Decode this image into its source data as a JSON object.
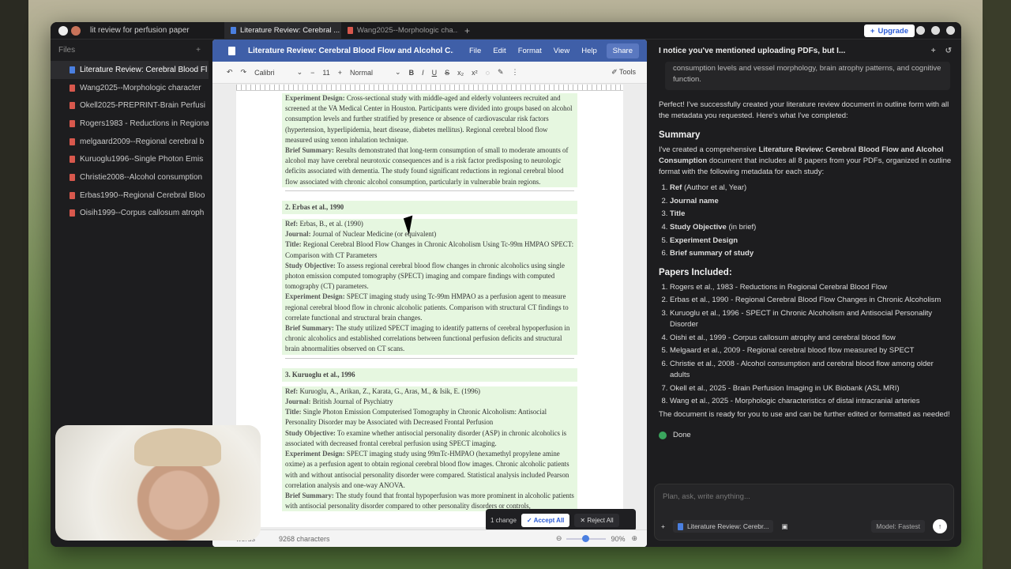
{
  "topbar": {
    "project": "lit review for perfusion paper",
    "tabs": [
      {
        "label": "Literature Review: Cerebral ...",
        "active": true,
        "icon": "doc-icon-blue"
      },
      {
        "label": "Wang2025--Morphologic cha...",
        "active": false,
        "icon": "pdf-icon-red"
      }
    ],
    "upgrade_label": "Upgrade"
  },
  "sidebar": {
    "title": "Files",
    "files": [
      {
        "name": "Literature Review: Cerebral Blood Fl",
        "icon": "doc-icon-blue"
      },
      {
        "name": "Wang2025--Morphologic character",
        "icon": "pdf-icon-red"
      },
      {
        "name": "Okell2025-PREPRINT-Brain Perfusi",
        "icon": "pdf-icon-red"
      },
      {
        "name": "Rogers1983 - Reductions in Regiona",
        "icon": "pdf-icon-red"
      },
      {
        "name": "melgaard2009--Regional cerebral b",
        "icon": "pdf-icon-red"
      },
      {
        "name": "Kuruoglu1996--Single Photon Emis",
        "icon": "pdf-icon-red"
      },
      {
        "name": "Christie2008--Alcohol consumption",
        "icon": "pdf-icon-red"
      },
      {
        "name": "Erbas1990--Regional Cerebral Bloo",
        "icon": "pdf-icon-red"
      },
      {
        "name": "Oisih1999--Corpus callosum atroph",
        "icon": "pdf-icon-red"
      }
    ]
  },
  "doc": {
    "title": "Literature Review: Cerebral Blood Flow and Alcohol C...",
    "menu": [
      "File",
      "Edit",
      "Format",
      "View",
      "Help"
    ],
    "share": "Share",
    "font": "Calibri",
    "size": "11",
    "style": "Normal",
    "tools": "Tools",
    "sec1": {
      "design_label": "Experiment Design:",
      "design": "Cross-sectional study with middle-aged and elderly volunteers recruited and screened at the VA Medical Center in Houston. Participants were divided into groups based on alcohol consumption levels and further stratified by presence or absence of cardiovascular risk factors (hypertension, hyperlipidemia, heart disease, diabetes mellitus). Regional cerebral blood flow measured using xenon inhalation technique.",
      "summary_label": "Brief Summary:",
      "summary": "Results demonstrated that long-term consumption of small to moderate amounts of alcohol may have cerebral neurotoxic consequences and is a risk factor predisposing to neurologic deficits associated with dementia. The study found significant reductions in regional cerebral blood flow associated with chronic alcohol consumption, particularly in vulnerable brain regions."
    },
    "sec2": {
      "heading": "2. Erbas et al., 1990",
      "ref_label": "Ref:",
      "ref": "Erbas, B., et al. (1990)",
      "journal_label": "Journal:",
      "journal": "Journal of Nuclear Medicine (or equivalent)",
      "title_label": "Title:",
      "title": "Regional Cerebral Blood Flow Changes in Chronic Alcoholism Using Tc-99m HMPAO SPECT: Comparison with CT Parameters",
      "obj_label": "Study Objective:",
      "obj": "To assess regional cerebral blood flow changes in chronic alcoholics using single photon emission computed tomography (SPECT) imaging and compare findings with computed tomography (CT) parameters.",
      "design_label": "Experiment Design:",
      "design": "SPECT imaging study using Tc-99m HMPAO as a perfusion agent to measure regional cerebral blood flow in chronic alcoholic patients. Comparison with structural CT findings to correlate functional and structural brain changes.",
      "summary_label": "Brief Summary:",
      "summary": "The study utilized SPECT imaging to identify patterns of cerebral hypoperfusion in chronic alcoholics and established correlations between functional perfusion deficits and structural brain abnormalities observed on CT scans."
    },
    "sec3": {
      "heading": "3. Kuruoglu et al., 1996",
      "ref_label": "Ref:",
      "ref": "Kuruoglu, A., Arikan, Z., Karata, G., Aras, M., & Isik, E. (1996)",
      "journal_label": "Journal:",
      "journal": "British Journal of Psychiatry",
      "title_label": "Title:",
      "title": "Single Photon Emission Computerised Tomography in Chronic Alcoholism: Antisocial Personality Disorder may be Associated with Decreased Frontal Perfusion",
      "obj_label": "Study Objective:",
      "obj": "To examine whether antisocial personality disorder (ASP) in chronic alcoholics is associated with decreased frontal cerebral perfusion using SPECT imaging.",
      "design_label": "Experiment Design:",
      "design": "SPECT imaging study using 99mTc-HMPAO (hexamethyl propylene amine oxime) as a perfusion agent to obtain regional cerebral blood flow images. Chronic alcoholic patients with and without antisocial personality disorder were compared. Statistical analysis included Pearson correlation analysis and one-way ANOVA.",
      "summary_label": "Brief Summary:",
      "summary": "The study found that frontal hypoperfusion was more prominent in alcoholic patients with antisocial personality disorder compared to other personality disorders or controls,"
    },
    "status": {
      "words": "words",
      "chars": "9268 characters",
      "zoom": "90%"
    },
    "changes": {
      "count": "1 change",
      "accept": "Accept All",
      "reject": "Reject All"
    }
  },
  "chat": {
    "title": "I notice you've mentioned uploading PDFs, but I...",
    "quote": "consumption levels and vessel morphology, brain atrophy patterns, and cognitive function.",
    "intro": "Perfect! I've successfully created your literature review document in outline form with all the metadata you requested. Here's what I've completed:",
    "summary_h": "Summary",
    "summary_p1": "I've created a comprehensive ",
    "summary_bold": "Literature Review: Cerebral Blood Flow and Alcohol Consumption",
    "summary_p2": " document that includes all 8 papers from your PDFs, organized in outline format with the following metadata for each study:",
    "fields": [
      {
        "b": "Ref",
        "t": " (Author et al, Year)"
      },
      {
        "b": "Journal name",
        "t": ""
      },
      {
        "b": "Title",
        "t": ""
      },
      {
        "b": "Study Objective",
        "t": " (in brief)"
      },
      {
        "b": "Experiment Design",
        "t": ""
      },
      {
        "b": "Brief summary of study",
        "t": ""
      }
    ],
    "papers_h": "Papers Included:",
    "papers": [
      "Rogers et al., 1983 - Reductions in Regional Cerebral Blood Flow",
      "Erbas et al., 1990 - Regional Cerebral Blood Flow Changes in Chronic Alcoholism",
      "Kuruoglu et al., 1996 - SPECT in Chronic Alcoholism and Antisocial Personality Disorder",
      "Oishi et al., 1999 - Corpus callosum atrophy and cerebral blood flow",
      "Melgaard et al., 2009 - Regional cerebral blood flow measured by SPECT",
      "Christie et al., 2008 - Alcohol consumption and cerebral blood flow among older adults",
      "Okell et al., 2025 - Brain Perfusion Imaging in UK Biobank (ASL MRI)",
      "Wang et al., 2025 - Morphologic characteristics of distal intracranial arteries"
    ],
    "closing": "The document is ready for you to use and can be further edited or formatted as needed!",
    "done": "Done",
    "input_placeholder": "Plan, ask, write anything...",
    "context_chip": "Literature Review: Cerebr...",
    "model_label": "Model:",
    "model": "Fastest"
  }
}
